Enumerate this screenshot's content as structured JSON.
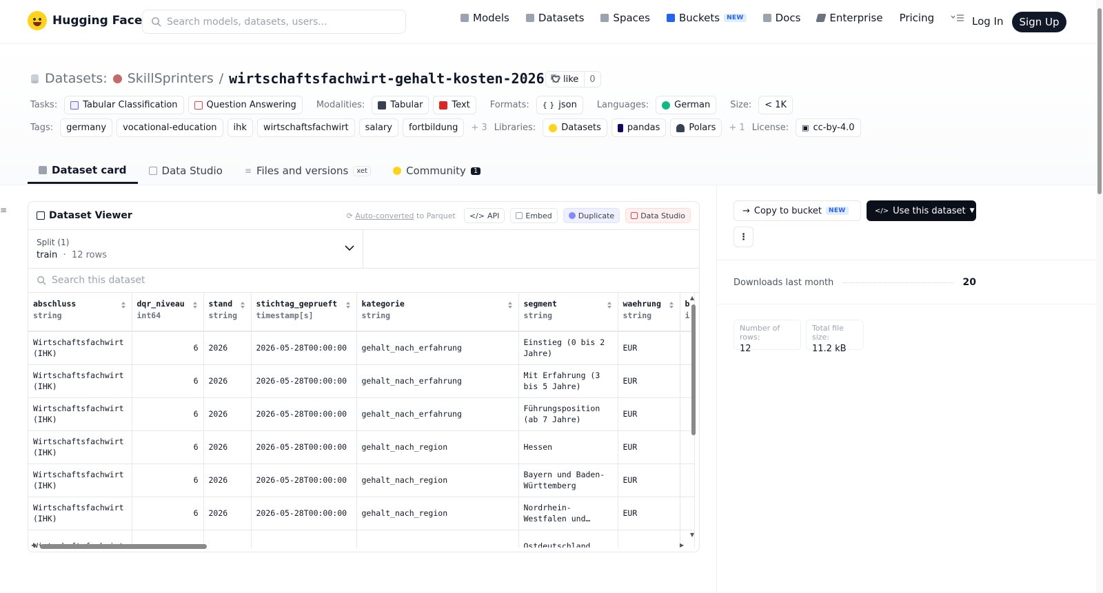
{
  "header": {
    "brand": "Hugging Face",
    "search_placeholder": "Search models, datasets, users...",
    "nav": [
      {
        "label": "Models",
        "color": "#9ca3af"
      },
      {
        "label": "Datasets",
        "color": "#9ca3af"
      },
      {
        "label": "Spaces",
        "color": "#9ca3af"
      },
      {
        "label": "Buckets",
        "color": "#2563eb",
        "badge": "NEW"
      },
      {
        "label": "Docs",
        "color": "#9ca3af"
      },
      {
        "label": "Enterprise",
        "color": "#6b7280"
      },
      {
        "label": "Pricing"
      }
    ],
    "login": "Log In",
    "signup": "Sign Up"
  },
  "dataset": {
    "prefix": "Datasets:",
    "org": "SkillSprinters",
    "name": "wirtschaftsfachwirt-gehalt-kosten-2026",
    "like_label": "like",
    "like_count": "0",
    "tasks_label": "Tasks:",
    "tasks": [
      "Tabular Classification",
      "Question Answering"
    ],
    "modalities_label": "Modalities:",
    "modalities": [
      "Tabular",
      "Text"
    ],
    "formats_label": "Formats:",
    "formats": [
      "json"
    ],
    "languages_label": "Languages:",
    "languages": [
      "German"
    ],
    "size_label": "Size:",
    "size": "< 1K",
    "tags_label": "Tags:",
    "tags": [
      "germany",
      "vocational-education",
      "ihk",
      "wirtschaftsfachwirt",
      "salary",
      "fortbildung"
    ],
    "tags_more": "+ 3",
    "libraries_label": "Libraries:",
    "libraries": [
      "Datasets",
      "pandas",
      "Polars"
    ],
    "libraries_more": "+ 1",
    "license_label": "License:",
    "license": "cc-by-4.0"
  },
  "tabs": [
    {
      "label": "Dataset card",
      "active": true
    },
    {
      "label": "Data Studio"
    },
    {
      "label": "Files and versions",
      "badge": "xet"
    },
    {
      "label": "Community",
      "count": "1"
    }
  ],
  "viewer": {
    "title": "Dataset Viewer",
    "auto_link": "Auto-converted",
    "auto_suffix": "to Parquet",
    "actions": [
      "API",
      "Embed",
      "Duplicate",
      "Data Studio"
    ],
    "split_label": "Split (1)",
    "split_value": "train",
    "split_rows": "12 rows",
    "search_placeholder": "Search this dataset",
    "columns": [
      {
        "name": "abschluss",
        "type": "string"
      },
      {
        "name": "dqr_niveau",
        "type": "int64"
      },
      {
        "name": "stand",
        "type": "string"
      },
      {
        "name": "stichtag_geprueft",
        "type": "timestamp[s]"
      },
      {
        "name": "kategorie",
        "type": "string"
      },
      {
        "name": "segment",
        "type": "string"
      },
      {
        "name": "waehrung",
        "type": "string"
      },
      {
        "name": "b",
        "type": "i"
      }
    ],
    "rows": [
      [
        "Wirtschaftsfachwirt (IHK)",
        "6",
        "2026",
        "2026-05-28T00:00:00",
        "gehalt_nach_erfahrung",
        "Einstieg (0 bis 2 Jahre)",
        "EUR",
        ""
      ],
      [
        "Wirtschaftsfachwirt (IHK)",
        "6",
        "2026",
        "2026-05-28T00:00:00",
        "gehalt_nach_erfahrung",
        "Mit Erfahrung (3 bis 5 Jahre)",
        "EUR",
        ""
      ],
      [
        "Wirtschaftsfachwirt (IHK)",
        "6",
        "2026",
        "2026-05-28T00:00:00",
        "gehalt_nach_erfahrung",
        "Führungsposition (ab 7 Jahre)",
        "EUR",
        ""
      ],
      [
        "Wirtschaftsfachwirt (IHK)",
        "6",
        "2026",
        "2026-05-28T00:00:00",
        "gehalt_nach_region",
        "Hessen",
        "EUR",
        ""
      ],
      [
        "Wirtschaftsfachwirt (IHK)",
        "6",
        "2026",
        "2026-05-28T00:00:00",
        "gehalt_nach_region",
        "Bayern und Baden-Württemberg",
        "EUR",
        ""
      ],
      [
        "Wirtschaftsfachwirt (IHK)",
        "6",
        "2026",
        "2026-05-28T00:00:00",
        "gehalt_nach_region",
        "Nordrhein-Westfalen und…",
        "EUR",
        ""
      ],
      [
        "Wirtschaftsfachwirt",
        "",
        "",
        "",
        "",
        "Ostdeutschland",
        "",
        ""
      ]
    ]
  },
  "sidebar": {
    "copy_bucket": "Copy to bucket",
    "copy_badge": "NEW",
    "use_dataset": "Use this dataset",
    "downloads_label": "Downloads last month",
    "downloads_value": "20",
    "rows_label": "Number of rows:",
    "rows_value": "12",
    "size_label": "Total file size:",
    "size_value": "11.2 kB"
  }
}
